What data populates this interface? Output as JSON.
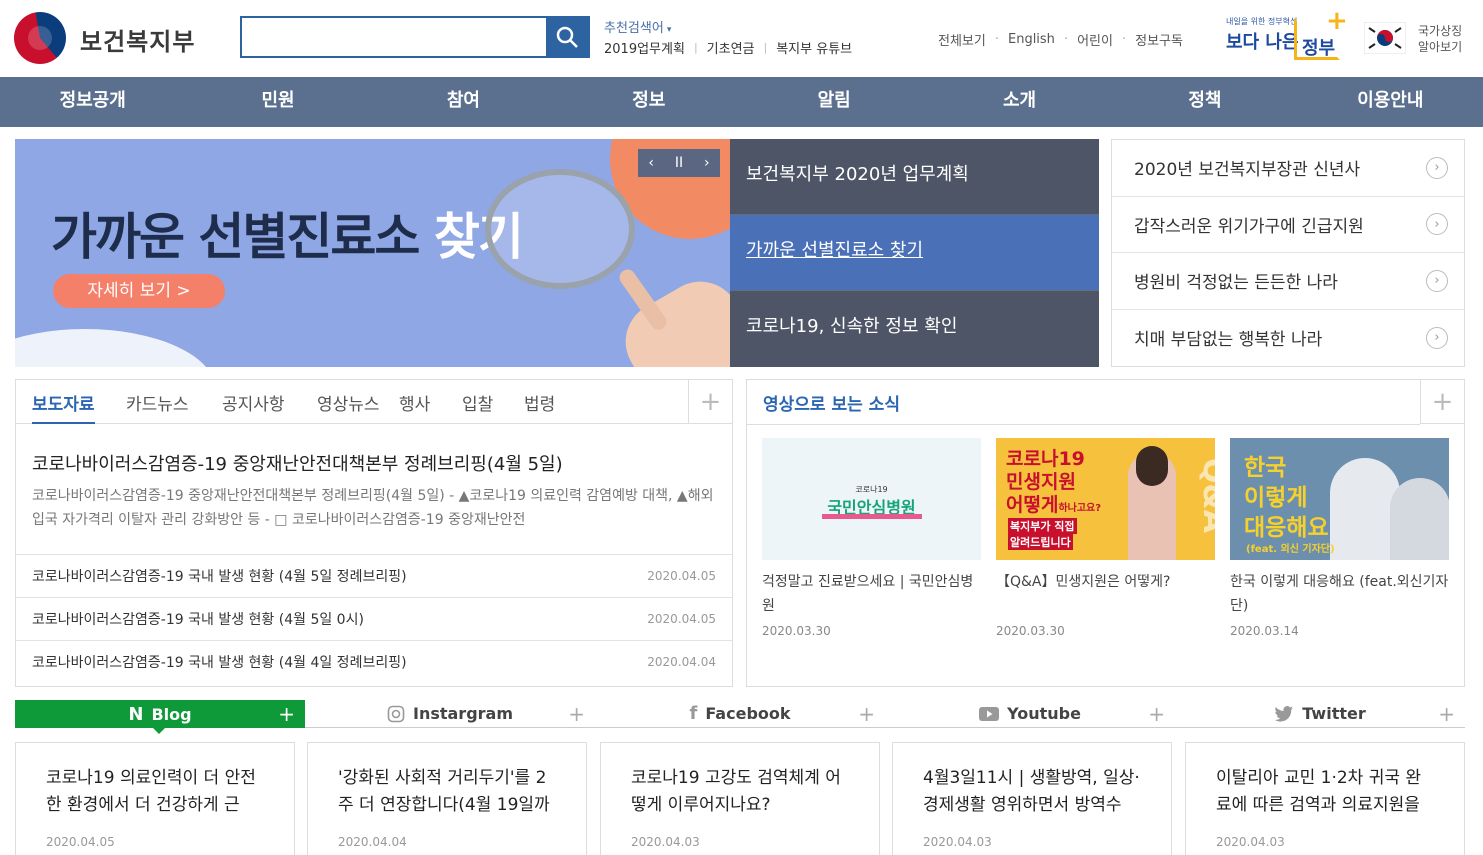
{
  "header": {
    "logo_text": "보건복지부",
    "search_placeholder": "",
    "recommend_label": "추천검색어",
    "recommend_links": [
      "2019업무계획",
      "기초연금",
      "복지부 유튜브"
    ],
    "util_links": [
      "전체보기",
      "English",
      "어린이",
      "정보구독"
    ],
    "badge_top": "내일을 위한 정부혁신",
    "badge_main_1": "보다 나은",
    "badge_main_2": "정부",
    "symbol_line1": "국가상징",
    "symbol_line2": "알아보기"
  },
  "gnb": [
    "정보공개",
    "민원",
    "참여",
    "정보",
    "알림",
    "소개",
    "정책",
    "이용안내"
  ],
  "banner": {
    "title_dark": "가까운 선별진료소",
    "title_white": "찾기",
    "button": "자세히 보기 >",
    "controls": [
      "‹",
      "II",
      "›"
    ]
  },
  "banner_list": [
    "보건복지부 2020년 업무계획",
    "가까운 선별진료소 찾기",
    "코로나19, 신속한 정보 확인"
  ],
  "quick_links": [
    "2020년 보건복지부장관 신년사",
    "갑작스러운 위기가구에 긴급지원",
    "병원비 걱정없는 든든한 나라",
    "치매 부담없는 행복한 나라"
  ],
  "news": {
    "tabs": [
      "보도자료",
      "카드뉴스",
      "공지사항",
      "영상뉴스",
      "행사",
      "입찰",
      "법령"
    ],
    "headline": "코로나바이러스감염증-19 중앙재난안전대책본부 정례브리핑(4월 5일)",
    "summary": "코로나바이러스감염증-19 중앙재난안전대책본부 정례브리핑(4월 5일) - ▲코로나19 의료인력 감염예방 대책, ▲해외입국 자가격리 이탈자 관리 강화방안 등 - □ 코로나바이러스감염증-19 중앙재난안전",
    "rows": [
      {
        "title": "코로나바이러스감염증-19 국내 발생 현황 (4월 5일 정례브리핑)",
        "date": "2020.04.05"
      },
      {
        "title": "코로나바이러스감염증-19 국내 발생 현황 (4월 5일 0시)",
        "date": "2020.04.05"
      },
      {
        "title": "코로나바이러스감염증-19 국내 발생 현황 (4월 4일 정례브리핑)",
        "date": "2020.04.04"
      }
    ]
  },
  "video": {
    "title": "영상으로 보는 소식",
    "items": [
      {
        "thumb_small": "코로나19",
        "thumb_main": "국민안심병원",
        "caption": "걱정말고 진료받으세요 | 국민안심병원",
        "date": "2020.03.30"
      },
      {
        "thumb_l1": "코로나19",
        "thumb_l2": "민생지원",
        "thumb_l3": "어떻게",
        "thumb_l3b": "하나고요?",
        "thumb_l4": "복지부가 직접",
        "thumb_l5": "알려드립니다",
        "thumb_side": "Q&A",
        "caption": "【Q&A】민생지원은 어떻게?",
        "date": "2020.03.30"
      },
      {
        "thumb_l1": "한국",
        "thumb_l2": "이렇게",
        "thumb_l3": "대응해요",
        "thumb_l4": "(feat. 외신 기자단)",
        "caption": "한국 이렇게 대응해요 (feat.외신기자단)",
        "date": "2020.03.14"
      }
    ]
  },
  "sns": {
    "tabs": [
      "Blog",
      "Instargram",
      "Facebook",
      "Youtube",
      "Twitter"
    ],
    "plus": "+",
    "cards": [
      {
        "title": "코로나19 의료인력이 더 안전한 환경에서 더 건강하게 근",
        "date": "2020.04.05"
      },
      {
        "title": "'강화된 사회적 거리두기'를 2주 더 연장합니다(4월 19일까",
        "date": "2020.04.04"
      },
      {
        "title": "코로나19 고강도 검역체계 어떻게 이루어지나요?",
        "date": "2020.04.03"
      },
      {
        "title": "4월3일11시 | 생활방역, 일상·경제생활 영위하면서 방역수",
        "date": "2020.04.03"
      },
      {
        "title": "이탈리아 교민 1·2차 귀국 완료에 따른 검역과 의료지원을",
        "date": "2020.04.03"
      }
    ]
  },
  "colors": {
    "nav_bg": "#5b6f8e",
    "accent_blue": "#2b66b3",
    "blog_green": "#0f9a3a",
    "banner_bg": "#8fa7e4"
  }
}
